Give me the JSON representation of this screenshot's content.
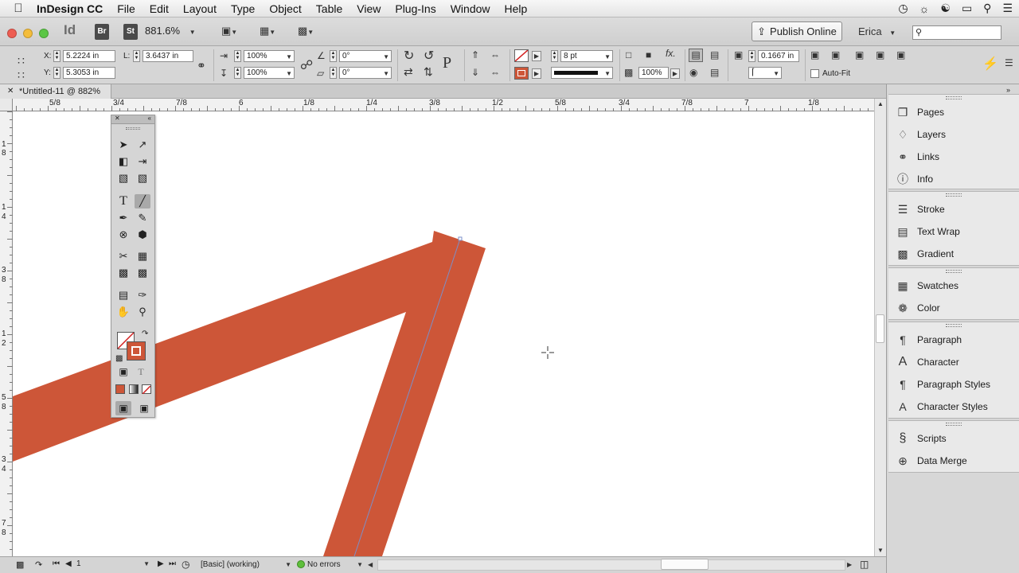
{
  "menubar": {
    "app_name": "InDesign CC",
    "items": [
      "File",
      "Edit",
      "Layout",
      "Type",
      "Object",
      "Table",
      "View",
      "Plug-Ins",
      "Window",
      "Help"
    ]
  },
  "appbar": {
    "logo": "Id",
    "bridge": "Br",
    "stock": "St",
    "zoom": "881.6%",
    "publish_label": "Publish Online",
    "user": "Erica",
    "search_placeholder": ""
  },
  "control": {
    "x_label": "X:",
    "x_value": "5.2224 in",
    "y_label": "Y:",
    "y_value": "5.3053 in",
    "l_label": "L:",
    "l_value": "3.6437 in",
    "scale_x": "100%",
    "scale_y": "100%",
    "rotate": "0°",
    "shear": "0°",
    "stroke_weight": "8 pt",
    "opacity": "100%",
    "fit_value": "0.1667 in",
    "autofit_label": "Auto-Fit",
    "autofit_checked": false
  },
  "document": {
    "tab_title": "*Untitled-11 @ 882%"
  },
  "ruler": {
    "horizontal_labels": [
      "5/8",
      "3/4",
      "7/8",
      "6",
      "1/8",
      "1/4",
      "3/8",
      "1/2",
      "5/8",
      "3/4",
      "7/8",
      "7",
      "1/8"
    ],
    "vertical_labels": [
      "1",
      "8",
      "1",
      "4",
      "3",
      "8",
      "1",
      "2",
      "5",
      "8",
      "3",
      "4",
      "7",
      "8"
    ]
  },
  "status": {
    "page": "1",
    "preflight_profile": "[Basic] (working)",
    "errors": "No errors"
  },
  "panels": {
    "groups": [
      [
        "Pages",
        "Layers",
        "Links",
        "Info"
      ],
      [
        "Stroke",
        "Text Wrap",
        "Gradient"
      ],
      [
        "Swatches",
        "Color"
      ],
      [
        "Paragraph",
        "Character",
        "Paragraph Styles",
        "Character Styles"
      ],
      [
        "Scripts",
        "Data Merge"
      ]
    ]
  },
  "colors": {
    "stroke_color": "#cd5638",
    "path_highlight": "#7b8fc9",
    "canvas": "#ffffff",
    "red_button": "#ee5d52",
    "yellow_button": "#f4bd3b",
    "green_button": "#5bc645"
  }
}
